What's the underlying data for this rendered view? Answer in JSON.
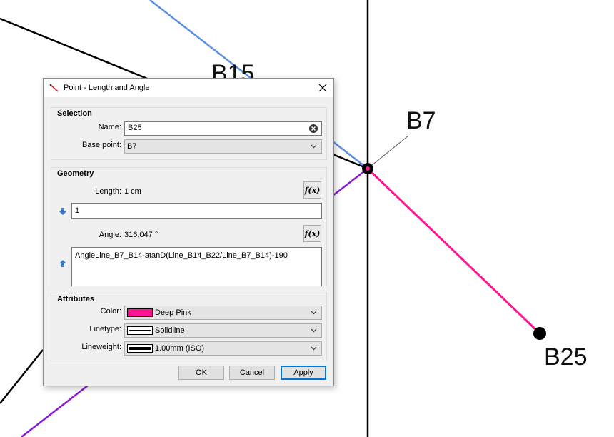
{
  "canvas": {
    "labels": {
      "b15": "B15",
      "b7": "B7",
      "b25": "B25"
    },
    "colors": {
      "blue_line": "#5b8fe0",
      "pink_line": "#ff1493",
      "purple_line": "#8a1ad6",
      "black_line": "#000000"
    }
  },
  "dialog": {
    "title": "Point - Length and Angle",
    "selection": {
      "group_title": "Selection",
      "name_label": "Name:",
      "name_value": "B25",
      "base_point_label": "Base point:",
      "base_point_value": "B7"
    },
    "geometry": {
      "group_title": "Geometry",
      "length_label": "Length:",
      "length_value": "1 cm",
      "length_formula": "1",
      "angle_label": "Angle:",
      "angle_value": "316,047 °",
      "angle_formula": "AngleLine_B7_B14-atanD(Line_B14_B22/Line_B7_B14)-190",
      "fx_label": "f(x)"
    },
    "attributes": {
      "group_title": "Attributes",
      "color_label": "Color:",
      "color_value": "Deep Pink",
      "color_hex": "#ff1493",
      "linetype_label": "Linetype:",
      "linetype_value": "Solidline",
      "lineweight_label": "Lineweight:",
      "lineweight_value": "1.00mm (ISO)"
    },
    "buttons": {
      "ok": "OK",
      "cancel": "Cancel",
      "apply": "Apply"
    }
  }
}
